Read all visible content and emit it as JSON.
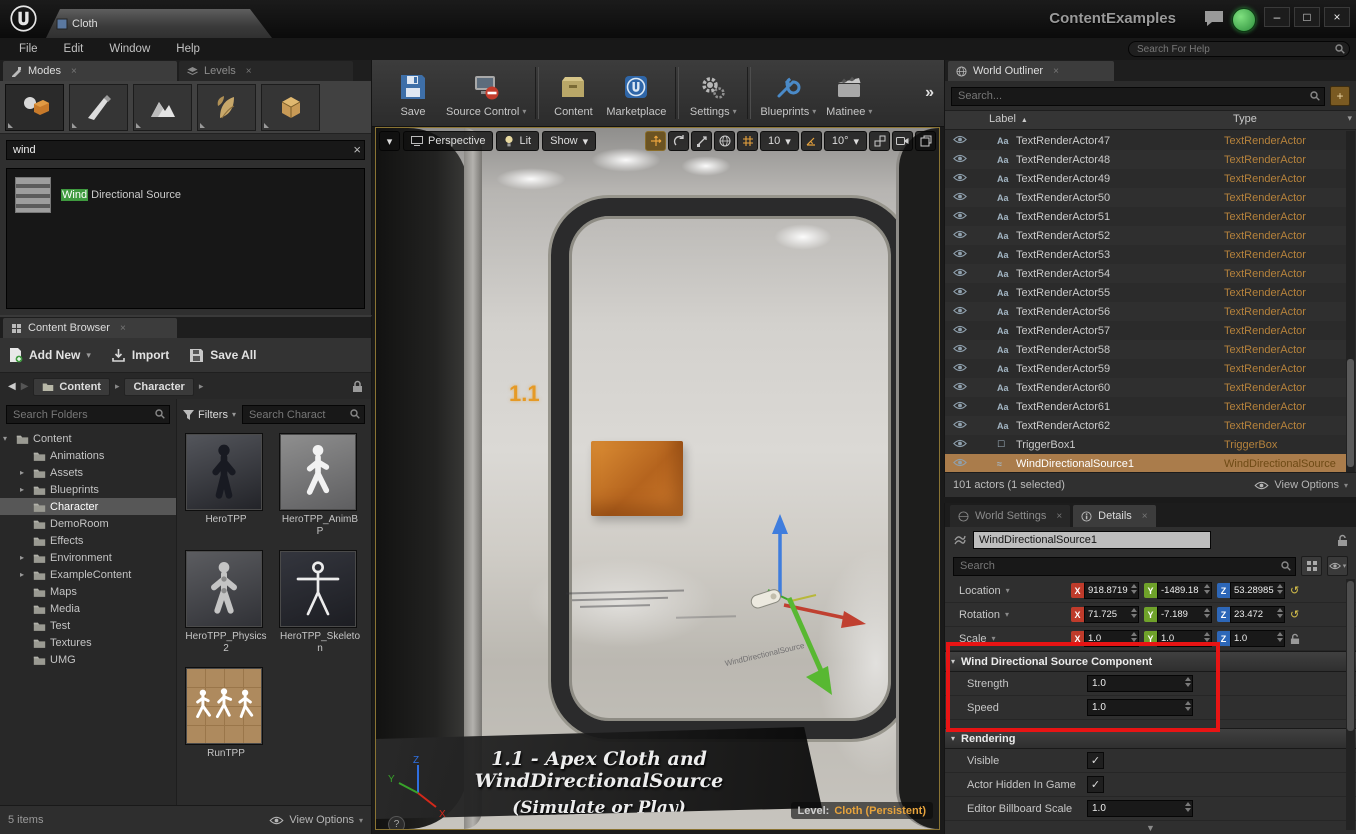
{
  "titlebar": {
    "tab_label": "Cloth",
    "project_title": "ContentExamples"
  },
  "menubar": {
    "items": [
      "File",
      "Edit",
      "Window",
      "Help"
    ],
    "help_search_placeholder": "Search For Help"
  },
  "main_toolbar": {
    "save": "Save",
    "source_control": "Source Control",
    "content": "Content",
    "marketplace": "Marketplace",
    "settings": "Settings",
    "blueprints": "Blueprints",
    "matinee": "Matinee"
  },
  "axes": {
    "x": "X",
    "y": "Y",
    "z": "Z"
  },
  "modes_panel": {
    "tab_modes": "Modes",
    "tab_levels": "Levels",
    "search_value": "wind",
    "result_highlight": "Wind",
    "result_rest": " Directional Source"
  },
  "content_browser": {
    "tab_label": "Content Browser",
    "add_new": "Add New",
    "import": "Import",
    "save_all": "Save All",
    "crumb_root": "Content",
    "crumb_current": "Character",
    "search_folders_placeholder": "Search Folders",
    "filters_label": "Filters",
    "search_assets_placeholder": "Search Charact",
    "folders": [
      {
        "name": "Content",
        "root": true
      },
      {
        "name": "Animations"
      },
      {
        "name": "Assets",
        "expandable": true
      },
      {
        "name": "Blueprints",
        "expandable": true
      },
      {
        "name": "Character",
        "selected": true
      },
      {
        "name": "DemoRoom"
      },
      {
        "name": "Effects"
      },
      {
        "name": "Environment",
        "expandable": true
      },
      {
        "name": "ExampleContent",
        "expandable": true
      },
      {
        "name": "Maps"
      },
      {
        "name": "Media"
      },
      {
        "name": "Test"
      },
      {
        "name": "Textures"
      },
      {
        "name": "UMG"
      }
    ],
    "assets": [
      {
        "name": "HeroTPP"
      },
      {
        "name": "HeroTPP_AnimBP"
      },
      {
        "name": "HeroTPP_Physics2"
      },
      {
        "name": "HeroTPP_Skeleton"
      },
      {
        "name": "RunTPP"
      }
    ],
    "item_count": "5 items",
    "view_options": "View Options"
  },
  "viewport": {
    "perspective": "Perspective",
    "lit": "Lit",
    "show": "Show",
    "grid_snap": "10",
    "rotation_snap": "10°",
    "scene_number": "1.1",
    "gizmo_label": "WindDirectionalSource",
    "caption_title": "1.1 - Apex Cloth and WindDirectionalSource",
    "caption_subtitle": "(Simulate or Play)",
    "level_label": "Level:",
    "level_name": "Cloth (Persistent)"
  },
  "world_outliner": {
    "tab_label": "World Outliner",
    "search_placeholder": "Search...",
    "col_label": "Label",
    "col_type": "Type",
    "rows": [
      {
        "label": "TextRenderActor47",
        "type": "TextRenderActor",
        "icon": "Aa"
      },
      {
        "label": "TextRenderActor48",
        "type": "TextRenderActor",
        "icon": "Aa"
      },
      {
        "label": "TextRenderActor49",
        "type": "TextRenderActor",
        "icon": "Aa"
      },
      {
        "label": "TextRenderActor50",
        "type": "TextRenderActor",
        "icon": "Aa"
      },
      {
        "label": "TextRenderActor51",
        "type": "TextRenderActor",
        "icon": "Aa"
      },
      {
        "label": "TextRenderActor52",
        "type": "TextRenderActor",
        "icon": "Aa"
      },
      {
        "label": "TextRenderActor53",
        "type": "TextRenderActor",
        "icon": "Aa"
      },
      {
        "label": "TextRenderActor54",
        "type": "TextRenderActor",
        "icon": "Aa"
      },
      {
        "label": "TextRenderActor55",
        "type": "TextRenderActor",
        "icon": "Aa"
      },
      {
        "label": "TextRenderActor56",
        "type": "TextRenderActor",
        "icon": "Aa"
      },
      {
        "label": "TextRenderActor57",
        "type": "TextRenderActor",
        "icon": "Aa"
      },
      {
        "label": "TextRenderActor58",
        "type": "TextRenderActor",
        "icon": "Aa"
      },
      {
        "label": "TextRenderActor59",
        "type": "TextRenderActor",
        "icon": "Aa"
      },
      {
        "label": "TextRenderActor60",
        "type": "TextRenderActor",
        "icon": "Aa"
      },
      {
        "label": "TextRenderActor61",
        "type": "TextRenderActor",
        "icon": "Aa"
      },
      {
        "label": "TextRenderActor62",
        "type": "TextRenderActor",
        "icon": "Aa"
      },
      {
        "label": "TriggerBox1",
        "type": "TriggerBox",
        "icon": "☐"
      },
      {
        "label": "WindDirectionalSource1",
        "type": "WindDirectionalSource",
        "icon": "≈",
        "selected": true
      }
    ],
    "status": "101 actors (1 selected)",
    "view_options": "View Options"
  },
  "details": {
    "tab_world_settings": "World Settings",
    "tab_details": "Details",
    "actor_name": "WindDirectionalSource1",
    "search_placeholder": "Search",
    "transform": [
      {
        "label": "Location",
        "x": "918.8719",
        "y": "-1489.18",
        "z": "53.28985",
        "reset": true
      },
      {
        "label": "Rotation",
        "x": "71.725",
        "y": "-7.189",
        "z": "23.472",
        "reset": true
      },
      {
        "label": "Scale",
        "x": "1.0",
        "y": "1.0",
        "z": "1.0",
        "lock": true
      }
    ],
    "wind_section_title": "Wind Directional Source Component",
    "strength_label": "Strength",
    "strength_value": "1.0",
    "speed_label": "Speed",
    "speed_value": "1.0",
    "rendering_title": "Rendering",
    "visible_label": "Visible",
    "visible_checked": true,
    "hidden_label": "Actor Hidden In Game",
    "hidden_checked": true,
    "billboard_label": "Editor Billboard Scale",
    "billboard_value": "1.0"
  }
}
